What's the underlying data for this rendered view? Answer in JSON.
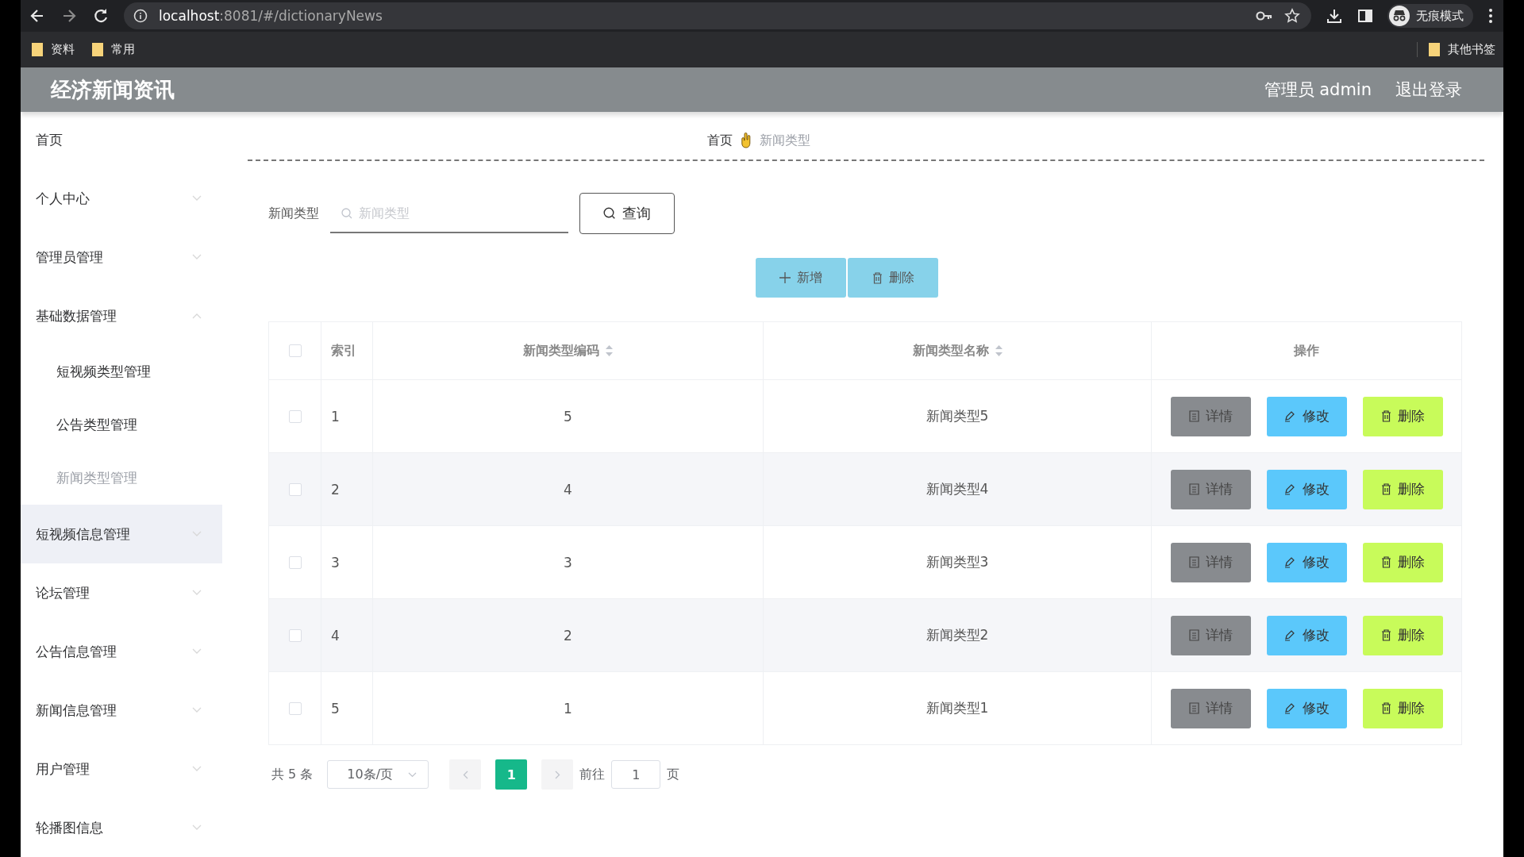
{
  "browser": {
    "url_host": "localhost",
    "url_rest": ":8081/#/dictionaryNews",
    "profile": "无痕模式",
    "bookmarks": [
      "资料",
      "常用"
    ],
    "other_bookmarks": "其他书签"
  },
  "header": {
    "title": "经济新闻资讯",
    "user": "管理员 admin",
    "logout": "退出登录"
  },
  "sidebar": {
    "items": [
      {
        "label": "首页",
        "kind": "link",
        "highlighted": false
      },
      {
        "label": "个人中心",
        "kind": "submenu",
        "expanded": false,
        "highlighted": false
      },
      {
        "label": "管理员管理",
        "kind": "submenu",
        "expanded": false,
        "highlighted": false
      },
      {
        "label": "基础数据管理",
        "kind": "submenu",
        "expanded": true,
        "highlighted": false,
        "children": [
          {
            "label": "短视频类型管理",
            "selected": false
          },
          {
            "label": "公告类型管理",
            "selected": false
          },
          {
            "label": "新闻类型管理",
            "selected": true
          }
        ]
      },
      {
        "label": "短视频信息管理",
        "kind": "submenu",
        "expanded": false,
        "highlighted": true
      },
      {
        "label": "论坛管理",
        "kind": "submenu",
        "expanded": false,
        "highlighted": false
      },
      {
        "label": "公告信息管理",
        "kind": "submenu",
        "expanded": false,
        "highlighted": false
      },
      {
        "label": "新闻信息管理",
        "kind": "submenu",
        "expanded": false,
        "highlighted": false
      },
      {
        "label": "用户管理",
        "kind": "submenu",
        "expanded": false,
        "highlighted": false
      },
      {
        "label": "轮播图信息",
        "kind": "submenu",
        "expanded": false,
        "highlighted": false
      }
    ]
  },
  "breadcrumb": [
    {
      "label": "首页",
      "current": false
    },
    {
      "label": "新闻类型",
      "current": true
    }
  ],
  "search": {
    "label": "新闻类型",
    "placeholder": "新闻类型",
    "button": "查询"
  },
  "toolbar": [
    {
      "kind": "add",
      "label": "新增"
    },
    {
      "kind": "delete",
      "label": "删除"
    }
  ],
  "table": {
    "select_all": false,
    "columns": [
      {
        "label": "索引",
        "sortable": false
      },
      {
        "label": "新闻类型编码",
        "sortable": true
      },
      {
        "label": "新闻类型名称",
        "sortable": true
      },
      {
        "label": "操作",
        "sortable": false
      }
    ],
    "rows": [
      {
        "checked": false,
        "index": "1",
        "code": "5",
        "name": "新闻类型5",
        "actions": [
          {
            "kind": "detail",
            "label": "详情"
          },
          {
            "kind": "edit",
            "label": "修改"
          },
          {
            "kind": "delete",
            "label": "删除"
          }
        ]
      },
      {
        "checked": false,
        "index": "2",
        "code": "4",
        "name": "新闻类型4",
        "actions": [
          {
            "kind": "detail",
            "label": "详情"
          },
          {
            "kind": "edit",
            "label": "修改"
          },
          {
            "kind": "delete",
            "label": "删除"
          }
        ]
      },
      {
        "checked": false,
        "index": "3",
        "code": "3",
        "name": "新闻类型3",
        "actions": [
          {
            "kind": "detail",
            "label": "详情"
          },
          {
            "kind": "edit",
            "label": "修改"
          },
          {
            "kind": "delete",
            "label": "删除"
          }
        ]
      },
      {
        "checked": false,
        "index": "4",
        "code": "2",
        "name": "新闻类型2",
        "actions": [
          {
            "kind": "detail",
            "label": "详情"
          },
          {
            "kind": "edit",
            "label": "修改"
          },
          {
            "kind": "delete",
            "label": "删除"
          }
        ]
      },
      {
        "checked": false,
        "index": "5",
        "code": "1",
        "name": "新闻类型1",
        "actions": [
          {
            "kind": "detail",
            "label": "详情"
          },
          {
            "kind": "edit",
            "label": "修改"
          },
          {
            "kind": "delete",
            "label": "删除"
          }
        ]
      }
    ]
  },
  "pagination": {
    "total": "共 5 条",
    "page_size": "10条/页",
    "pages": [
      {
        "label": "1",
        "selected": true
      }
    ],
    "goto_label": "前往",
    "goto_value": "1",
    "goto_suffix": "页"
  }
}
